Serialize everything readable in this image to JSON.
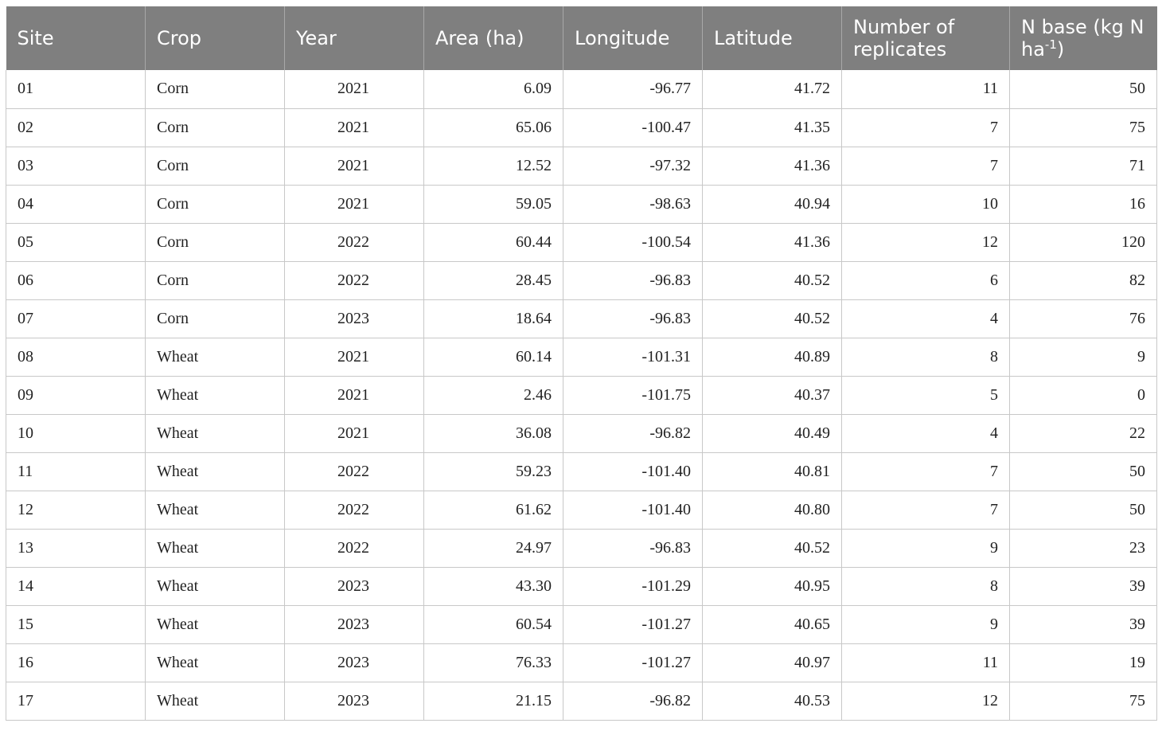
{
  "table": {
    "headers": {
      "site": "Site",
      "crop": "Crop",
      "year": "Year",
      "area": "Area (ha)",
      "longitude": "Longitude",
      "latitude": "Latitude",
      "replicates": "Number of replicates",
      "nbase_prefix": "N base (kg N ha",
      "nbase_sup": "-1",
      "nbase_suffix": ")"
    },
    "rows": [
      [
        "01",
        "Corn",
        "2021",
        "6.09",
        "-96.77",
        "41.72",
        "11",
        "50"
      ],
      [
        "02",
        "Corn",
        "2021",
        "65.06",
        "-100.47",
        "41.35",
        "7",
        "75"
      ],
      [
        "03",
        "Corn",
        "2021",
        "12.52",
        "-97.32",
        "41.36",
        "7",
        "71"
      ],
      [
        "04",
        "Corn",
        "2021",
        "59.05",
        "-98.63",
        "40.94",
        "10",
        "16"
      ],
      [
        "05",
        "Corn",
        "2022",
        "60.44",
        "-100.54",
        "41.36",
        "12",
        "120"
      ],
      [
        "06",
        "Corn",
        "2022",
        "28.45",
        "-96.83",
        "40.52",
        "6",
        "82"
      ],
      [
        "07",
        "Corn",
        "2023",
        "18.64",
        "-96.83",
        "40.52",
        "4",
        "76"
      ],
      [
        "08",
        "Wheat",
        "2021",
        "60.14",
        "-101.31",
        "40.89",
        "8",
        "9"
      ],
      [
        "09",
        "Wheat",
        "2021",
        "2.46",
        "-101.75",
        "40.37",
        "5",
        "0"
      ],
      [
        "10",
        "Wheat",
        "2021",
        "36.08",
        "-96.82",
        "40.49",
        "4",
        "22"
      ],
      [
        "11",
        "Wheat",
        "2022",
        "59.23",
        "-101.40",
        "40.81",
        "7",
        "50"
      ],
      [
        "12",
        "Wheat",
        "2022",
        "61.62",
        "-101.40",
        "40.80",
        "7",
        "50"
      ],
      [
        "13",
        "Wheat",
        "2022",
        "24.97",
        "-96.83",
        "40.52",
        "9",
        "23"
      ],
      [
        "14",
        "Wheat",
        "2023",
        "43.30",
        "-101.29",
        "40.95",
        "8",
        "39"
      ],
      [
        "15",
        "Wheat",
        "2023",
        "60.54",
        "-101.27",
        "40.65",
        "9",
        "39"
      ],
      [
        "16",
        "Wheat",
        "2023",
        "76.33",
        "-101.27",
        "40.97",
        "11",
        "19"
      ],
      [
        "17",
        "Wheat",
        "2023",
        "21.15",
        "-96.82",
        "40.53",
        "12",
        "75"
      ]
    ]
  }
}
